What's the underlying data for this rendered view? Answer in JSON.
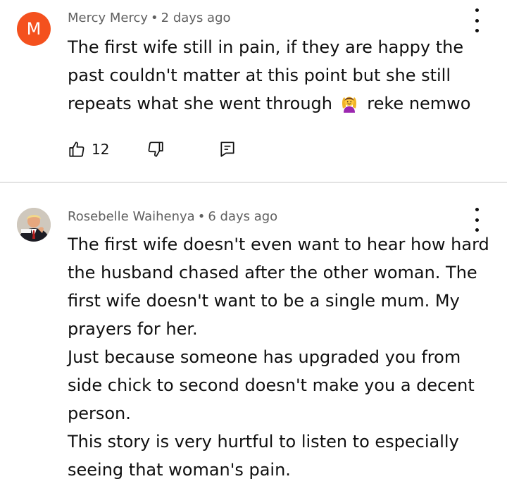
{
  "comments": [
    {
      "avatar_letter": "M",
      "avatar_color": "#f4511e",
      "author": "Mercy Mercy",
      "separator": "•",
      "time": "2 days ago",
      "text_before_emoji": "The first wife still in pain, if they are happy the past couldn't matter at this point but she still repeats what she went through",
      "emoji": "woman-raising-hands-emoji",
      "text_after_emoji": "reke nemwo",
      "like_count": "12",
      "icons": {
        "like": "thumbs-up-icon",
        "dislike": "thumbs-down-icon",
        "reply": "reply-icon",
        "menu": "more-vertical-icon"
      }
    },
    {
      "author": "Rosebelle Waihenya",
      "separator": "•",
      "time": "6 days ago",
      "paragraphs": [
        "The first wife doesn't even want to hear how hard the husband chased after the other woman. The first wife doesn't want to be a single mum. My prayers for her.",
        "Just because someone has upgraded you from side chick to second doesn't make you a decent person.",
        "This story is very hurtful to listen to especially seeing that woman's pain."
      ],
      "icons": {
        "menu": "more-vertical-icon"
      }
    }
  ],
  "colors": {
    "text": "#0f0f0f",
    "meta": "#606060",
    "divider": "#e3e3e3"
  }
}
